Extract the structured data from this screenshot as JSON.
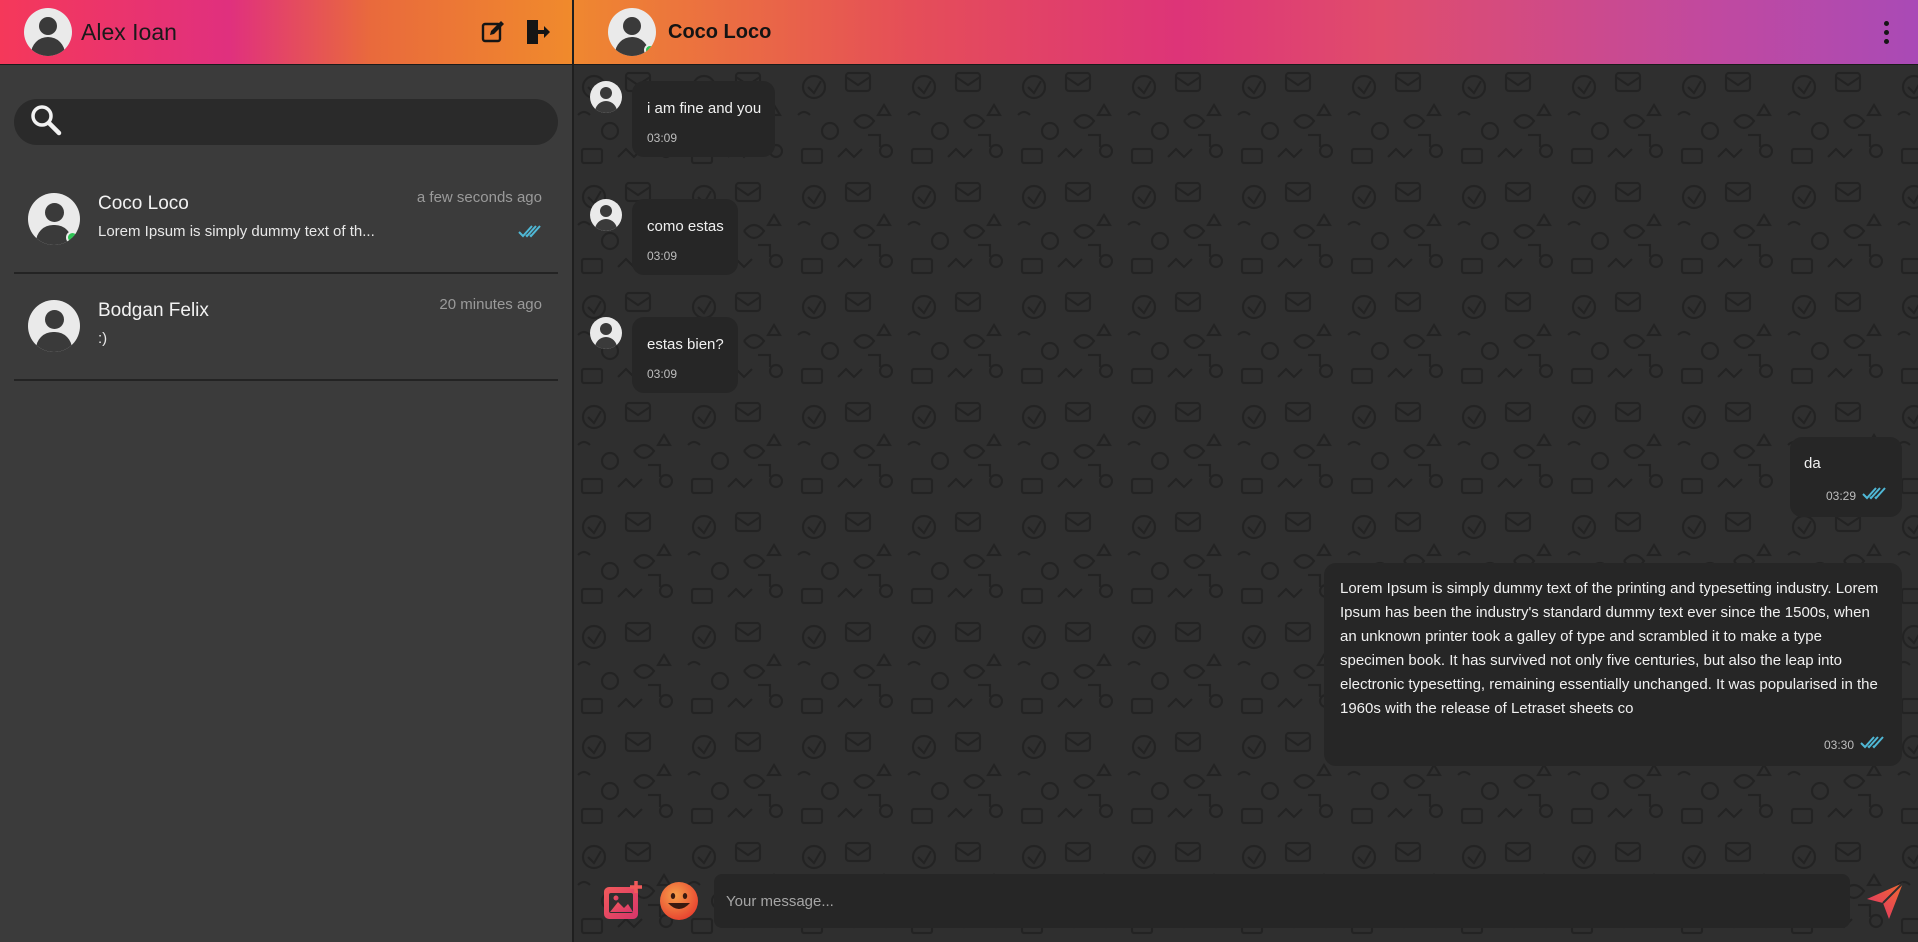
{
  "sidebar": {
    "user_name": "Alex Ioan",
    "search": {
      "value": "",
      "placeholder": ""
    },
    "chats": [
      {
        "name": "Coco Loco",
        "preview": "Lorem Ipsum is simply dummy text of th...",
        "time": "a few seconds ago",
        "online": true,
        "read": true
      },
      {
        "name": "Bodgan Felix",
        "preview": ":)",
        "time": "20 minutes ago",
        "online": false,
        "read": false
      }
    ]
  },
  "chat": {
    "contact_name": "Coco Loco",
    "messages": [
      {
        "direction": "in",
        "text": "i am fine and you",
        "time": "03:09"
      },
      {
        "direction": "in",
        "text": "como estas",
        "time": "03:09"
      },
      {
        "direction": "in",
        "text": "estas bien?",
        "time": "03:09"
      },
      {
        "direction": "out",
        "text": "da",
        "time": "03:29",
        "read": true
      },
      {
        "direction": "out",
        "text": "Lorem Ipsum is simply dummy text of the printing and typesetting industry. Lorem Ipsum has been the industry's standard dummy text ever since the 1500s, when an unknown printer took a galley of type and scrambled it to make a type specimen book. It has survived not only five centuries, but also the leap into electronic typesetting, remaining essentially unchanged. It was popularised in the 1960s with the release of Letraset sheets co",
        "time": "03:30",
        "read": true
      }
    ],
    "composer": {
      "placeholder": "Your message...",
      "value": ""
    }
  },
  "colors": {
    "online": "#2ec454",
    "read_check": "#4fb8d6",
    "send": "#e8403a"
  },
  "icons": [
    "user-avatar-icon",
    "edit-icon",
    "logout-icon",
    "search-icon",
    "double-check-icon",
    "more-vert-icon",
    "add-image-icon",
    "emoji-icon",
    "send-icon"
  ]
}
